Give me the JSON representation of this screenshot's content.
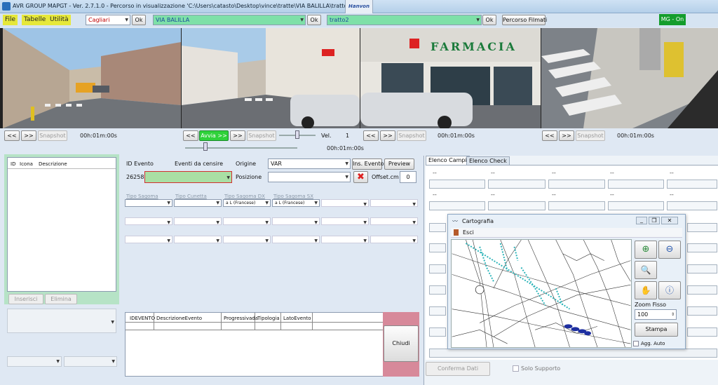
{
  "window": {
    "title": "AVR GROUP MAPGT - Ver. 2.7.1.0 - Percorso in visualizzazione 'C:\\Users\\catasto\\Desktop\\vince\\tratte\\VIA BALILLA\\tratto2'",
    "hanvon": "Hanvon"
  },
  "menu": {
    "file": "File",
    "tabelle": "Tabelle",
    "utilita": "Utilità"
  },
  "toolbar": {
    "city": "Cagliari",
    "street": "VIA BALILLA",
    "tratto": "tratto2",
    "ok": "Ok",
    "percorso_filmati": "Percorso Filmati",
    "mg_status": "MG - On"
  },
  "video": {
    "prev": "<<",
    "next": ">>",
    "snapshot": "Snapshot",
    "avvia": "Avvia >>",
    "vel_label": "Vel.",
    "vel_value": "1",
    "time": "00h:01m:00s"
  },
  "left_panel": {
    "col_id": "ID",
    "col_icona": "Icona",
    "col_descrizione": "Descrizione",
    "inserisci": "Inserisci",
    "elimina": "Elimina"
  },
  "event": {
    "id_label": "ID Evento",
    "id_value": "26258",
    "eventi_label": "Eventi da censire",
    "origine_label": "Origine",
    "origine_value": "VAR",
    "posizione_label": "Posizione",
    "ins_evento": "Ins. Evento",
    "preview": "Preview",
    "offset_label": "Offset.cm",
    "offset_value": "0",
    "tipo_sagoma": "Tipo Sagoma",
    "tipo_cunetta": "Tipo Cunetta",
    "tipo_sagoma_dx": "Tipo Sagoma DX",
    "tipo_sagoma_sx": "Tipo Sagoma SX",
    "sagoma_dx_value": "a L (Francese)",
    "sagoma_sx_value": "a L (Francese)"
  },
  "table": {
    "columns": [
      "IDEVENTO",
      "DescrizioneEvento",
      "Progressivada",
      "Tipologia",
      "LatoEvento"
    ],
    "chiudi": "Chiudi"
  },
  "right_panel": {
    "tab_campi": "Elenco Campi",
    "tab_check": "Elenco Check",
    "conferma": "Conferma Dati",
    "solo_supporto": "Solo Supporto"
  },
  "carto": {
    "title": "Cartografia",
    "esci": "Esci",
    "zoom_label": "Zoom Fisso",
    "zoom_value": "100",
    "stampa": "Stampa",
    "agg_auto": "Agg. Auto"
  },
  "colors": {
    "accent_green": "#149d2c",
    "menu_yellow": "#e6e83a",
    "street_green": "#7ee0a8",
    "map_route": "#1e2fa0",
    "map_highlight": "#2ab3b8"
  }
}
